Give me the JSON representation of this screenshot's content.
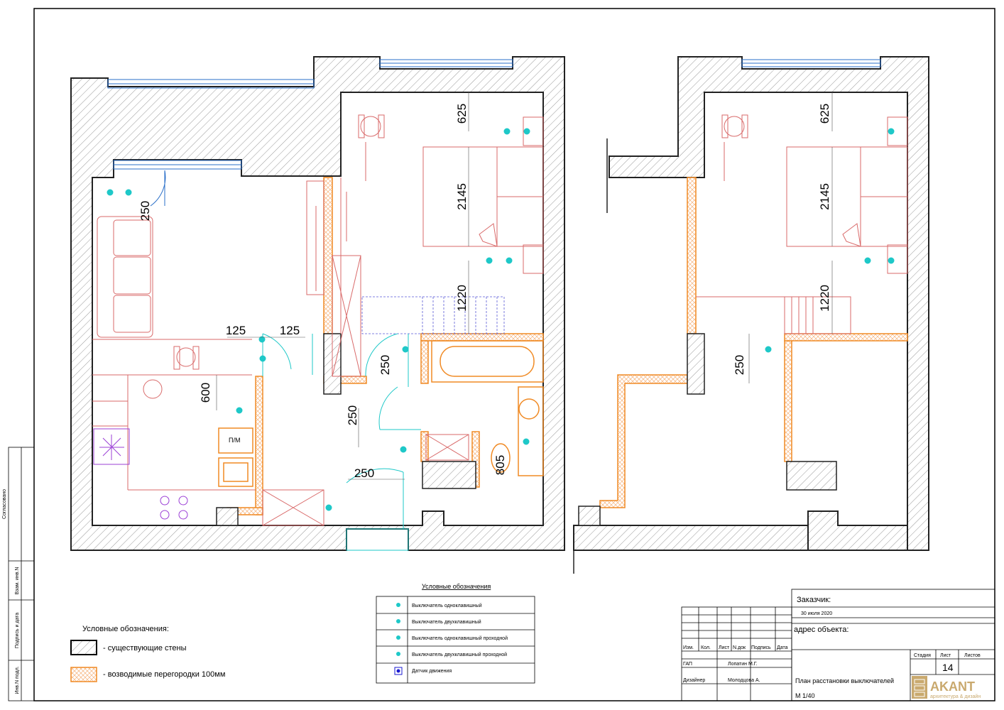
{
  "dimensions": {
    "left_plan": [
      "625",
      "2145",
      "1220",
      "250",
      "125",
      "125",
      "600",
      "250",
      "250",
      "250",
      "805"
    ],
    "right_plan": [
      "625",
      "2145",
      "1220",
      "250"
    ]
  },
  "labels": {
    "fridge": "П/М"
  },
  "legend_walls": {
    "title": "Условные обозначения:",
    "existing": "- существующие стены",
    "partitions": "- возводимые перегородки 100мм"
  },
  "legend_switches": {
    "title": "Условные обозначения",
    "items": [
      "Выключатель одноклавишный",
      "Выключатель двухклавишный",
      "Выключатель одноклавишный проходной",
      "Выключатель двухклавишный проходной",
      "Датчик движения"
    ]
  },
  "side_stamp": {
    "approved": "Согласовано",
    "inv_no": "Взам. инв.N",
    "sign_date": "Подпись и дата",
    "orig_inv": "Инв.N подл."
  },
  "title_block": {
    "customer_label": "Заказчик:",
    "date": "30 июля 2020",
    "address_label": "адрес объекта:",
    "cols": [
      "Изм.",
      "Кол.",
      "Лист",
      "N.док",
      "Подпись",
      "Дата"
    ],
    "gap_role": "ГАП",
    "gap_name": "Лопатин М.Г.",
    "designer_role": "Дизайнер",
    "designer_name": "Молодцова А.",
    "stage_label": "Стадия",
    "sheet_label": "Лист",
    "sheets_label": "Листов",
    "sheet_no": "14",
    "drawing_title": "План расстановки выключателей",
    "scale": "М 1/40",
    "logo_text": "AKANT",
    "logo_sub": "архитектура & дизайн"
  },
  "colors": {
    "wall": "#222222",
    "partition": "#f08a24",
    "furniture": "#d96a6a",
    "switch": "#1ec8c8",
    "window": "#2a6fc9",
    "door": "#1ec8c8",
    "motion": "#1a1ad0"
  }
}
